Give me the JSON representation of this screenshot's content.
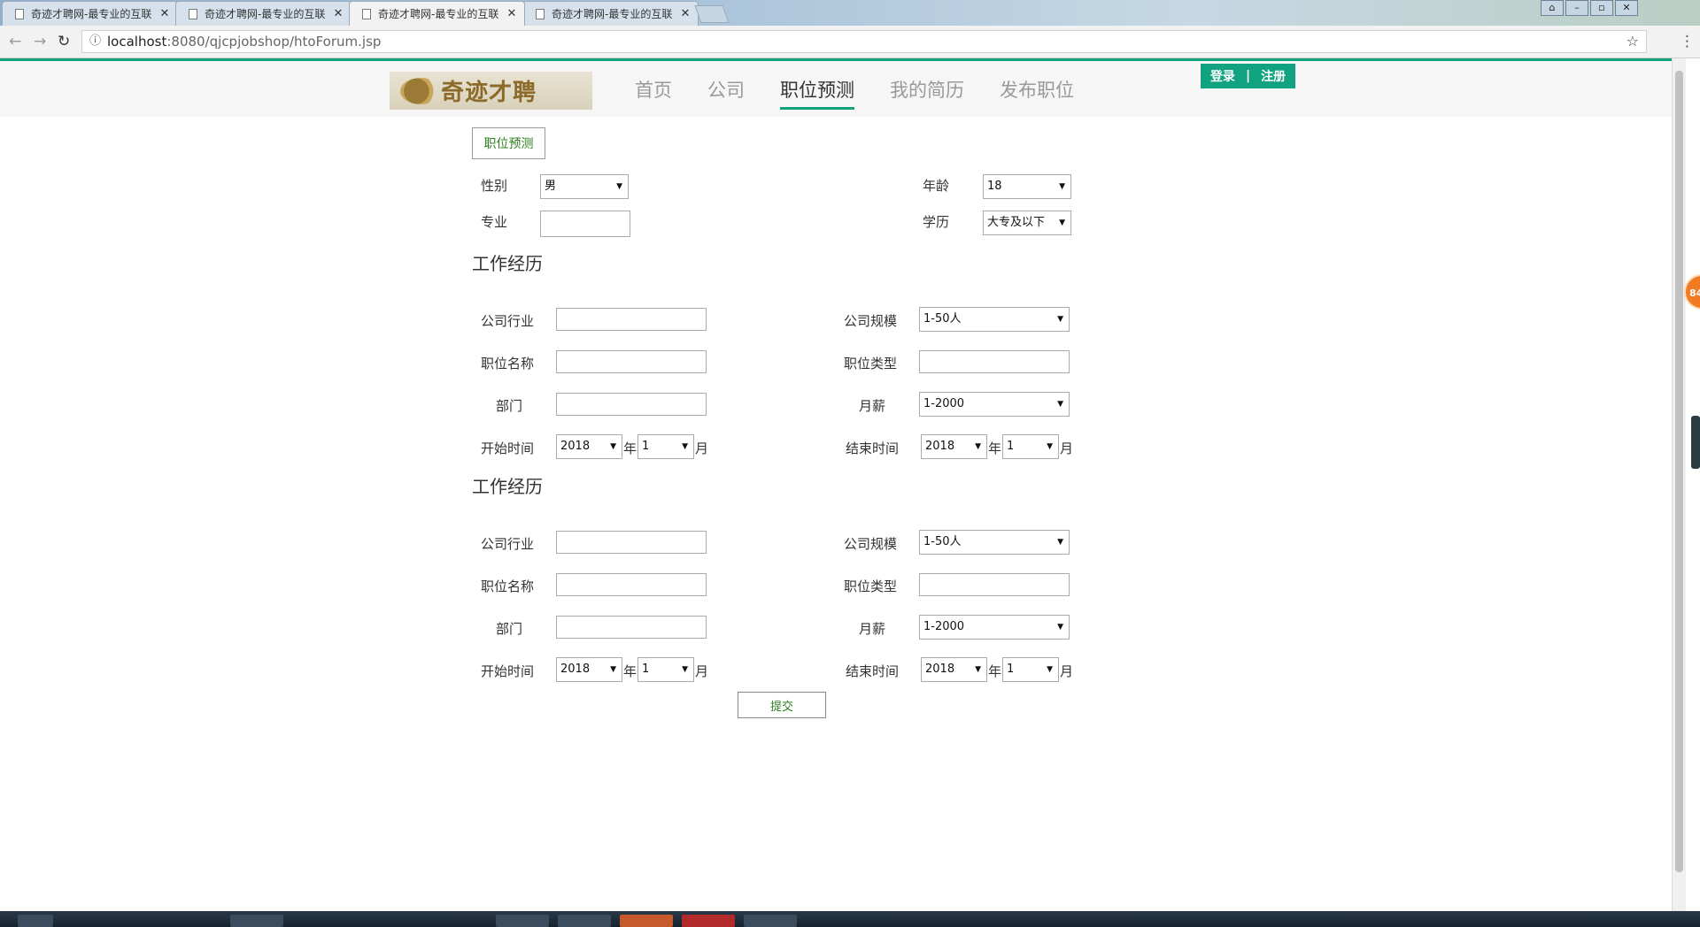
{
  "browser": {
    "tabs": [
      {
        "title": "奇迹才聘网-最专业的互联"
      },
      {
        "title": "奇迹才聘网-最专业的互联"
      },
      {
        "title": "奇迹才聘网-最专业的互联"
      },
      {
        "title": "奇迹才聘网-最专业的互联"
      }
    ],
    "url_host": "localhost",
    "url_path": ":8080/qjcpjobshop/htoForum.jsp"
  },
  "header": {
    "logo_text": "奇迹才聘",
    "nav": [
      "首页",
      "公司",
      "职位预测",
      "我的简历",
      "发布职位"
    ],
    "login": "登录",
    "separator": "|",
    "register": "注册"
  },
  "form": {
    "pill": "职位预测",
    "gender_label": "性别",
    "gender_value": "男",
    "age_label": "年龄",
    "age_value": "18",
    "major_label": "专业",
    "edu_label": "学历",
    "edu_value": "大专及以下",
    "experiences": [
      {
        "title": "工作经历",
        "industry_label": "公司行业",
        "scale_label": "公司规模",
        "scale_value": "1-50人",
        "position_label": "职位名称",
        "type_label": "职位类型",
        "dept_label": "部门",
        "salary_label": "月薪",
        "salary_value": "1-2000",
        "start_label": "开始时间",
        "start_year": "2018",
        "start_month": "1",
        "end_label": "结束时间",
        "end_year": "2018",
        "end_month": "1",
        "year_unit": "年",
        "month_unit": "月"
      },
      {
        "title": "工作经历",
        "industry_label": "公司行业",
        "scale_label": "公司规模",
        "scale_value": "1-50人",
        "position_label": "职位名称",
        "type_label": "职位类型",
        "dept_label": "部门",
        "salary_label": "月薪",
        "salary_value": "1-2000",
        "start_label": "开始时间",
        "start_year": "2018",
        "start_month": "1",
        "end_label": "结束时间",
        "end_year": "2018",
        "end_month": "1",
        "year_unit": "年",
        "month_unit": "月"
      }
    ],
    "submit": "提交"
  },
  "badge": "84",
  "colors": {
    "accent": "#11a37f",
    "link_green": "#2e7d1f",
    "badge": "#f07b22"
  },
  "icons": [
    "document-icon",
    "close-icon",
    "back-arrow-icon",
    "forward-arrow-icon",
    "reload-icon",
    "info-icon",
    "star-icon",
    "menu-icon",
    "dropdown-arrow-icon"
  ]
}
